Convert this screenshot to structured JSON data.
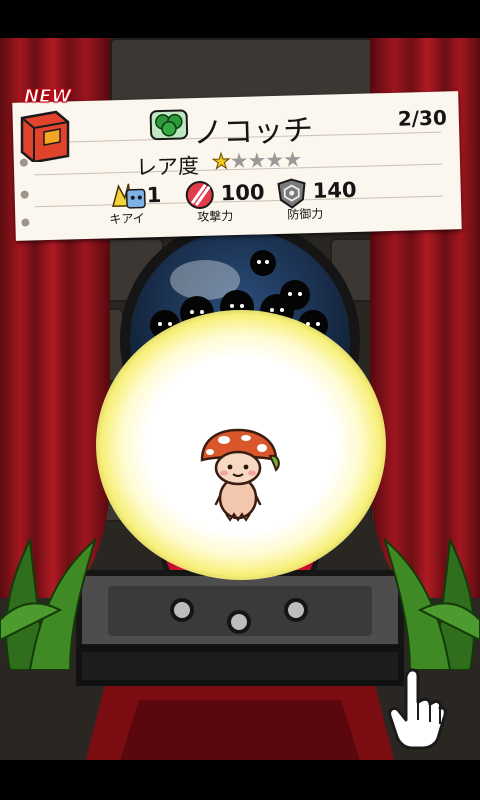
{
  "card": {
    "new_badge": "NEW",
    "name": "ノコッチ",
    "count": "2/30",
    "rarity_label": "レア度",
    "rarity": {
      "filled": 1,
      "total": 5
    },
    "stats": [
      {
        "icon": "kiai-icon",
        "value": "1",
        "label": "キアイ"
      },
      {
        "icon": "attack-icon",
        "value": "100",
        "label": "攻撃力"
      },
      {
        "icon": "defense-icon",
        "value": "140",
        "label": "防御力"
      }
    ]
  },
  "character": {
    "icon": "mushroom-character-icon"
  },
  "colors": {
    "curtain": "#a5161f",
    "glow": "#f7f07a",
    "crystal_ball": "#2b4d7a",
    "card_bg": "#fbf6ee"
  }
}
